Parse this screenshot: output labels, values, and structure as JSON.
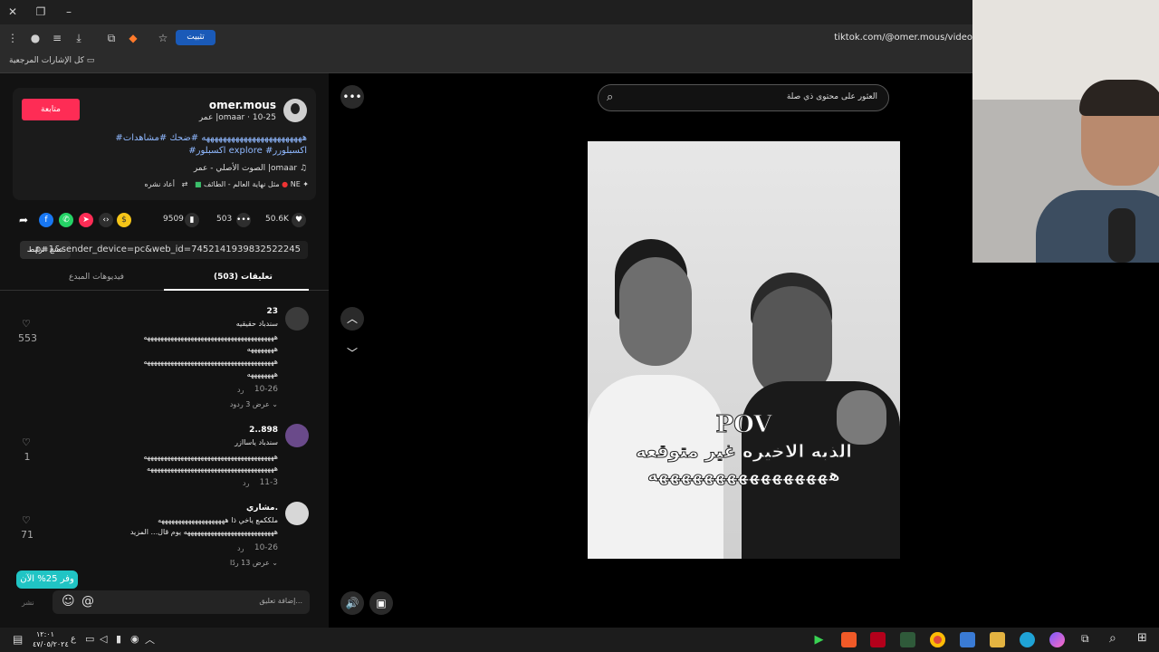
{
  "browser": {
    "url": "tiktok.com/@omer.mous/video",
    "install_label": "تثبيت",
    "bookmarks_label": "كل الإشارات المرجعية"
  },
  "profile": {
    "username": "omer.mous",
    "meta": "عمر |omaar · 10-25",
    "follow_label": "متابعة",
    "caption_line1": "#ههههههههههههههههههههههههه #ضحك #مشاهدات",
    "caption_line2": "#اكسبلور explore #اكسبلورر",
    "music": "الصوت الأصلي - عمر |omaar",
    "tag1": "NE",
    "tag2": "أعاد نشره",
    "tag3": "مثل نهاية العالم - الطائف"
  },
  "actions": {
    "likes": "50.6K",
    "comments": "503",
    "saves": "9509"
  },
  "link": {
    "copy_label": "نسخ الرابط",
    "url": "...p=1&sender_device=pc&web_id=7452141939832522245"
  },
  "tabs": {
    "comments": "تعليقات (503)",
    "creator_videos": "فيديوهات المبدع"
  },
  "comments": [
    {
      "user": "23",
      "text1": "سندباد حقيقيه",
      "text2": "هههههههههههههههههههههههههههههههههههههههه",
      "text3": "ههههههههه",
      "text4": "هههههههههههههههههههههههههههههههههههههههه",
      "text5": "ههههههههه",
      "date": "10-26",
      "reply": "رد",
      "more": "عرض 3 ردود",
      "likes": "553"
    },
    {
      "user": "2..898",
      "text1": "سندباد ياساازر",
      "text2": "هههههههههههههههههههههههههههههههههههههههه",
      "text3": "ههههههههههههههههههههههههههههههههههههههه",
      "date": "11-3",
      "reply": "رد",
      "likes": "1"
    },
    {
      "user": "مشاري.",
      "text1": "ملككمع ياخي ذا ههههههههههههههههههههه",
      "text2": "هههههههههههههههههههههههههههه يوم قال... المزيد",
      "date": "10-26",
      "reply": "رد",
      "more": "عرض 13 ردًا",
      "likes": "71"
    }
  ],
  "comment_box": {
    "placeholder": "إضافة تعليق...",
    "post_label": "نشر"
  },
  "promo": "وفر 25% الآن",
  "search": {
    "placeholder": "العثور على محتوى ذي صلة"
  },
  "video": {
    "overlay_line1": "POV",
    "overlay_line2": "الذبه الاخيره غير متوقعه",
    "overlay_line3": "ههههههههههههههههه"
  },
  "taskbar": {
    "time": "١٢:٠١",
    "date": "٤٧/٠٥/٢٠٢٤"
  }
}
